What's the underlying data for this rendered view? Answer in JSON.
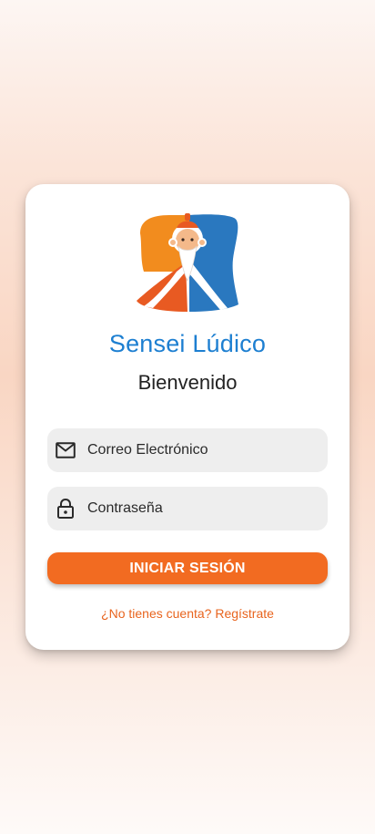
{
  "app": {
    "title": "Sensei Lúdico",
    "welcome": "Bienvenido",
    "logo_icon": "sensei-logo-icon"
  },
  "login": {
    "email_placeholder": "Correo Electrónico",
    "email_value": "",
    "email_icon": "mail-icon",
    "password_placeholder": "Contraseña",
    "password_value": "",
    "password_icon": "lock-icon",
    "submit_label": "INICIAR SESIÓN",
    "register_link": "¿No tienes cuenta? Regístrate"
  },
  "colors": {
    "brand_blue": "#1d7fd1",
    "accent_orange": "#f26b21",
    "link_orange": "#e8641e",
    "field_background": "#eeeeee"
  }
}
